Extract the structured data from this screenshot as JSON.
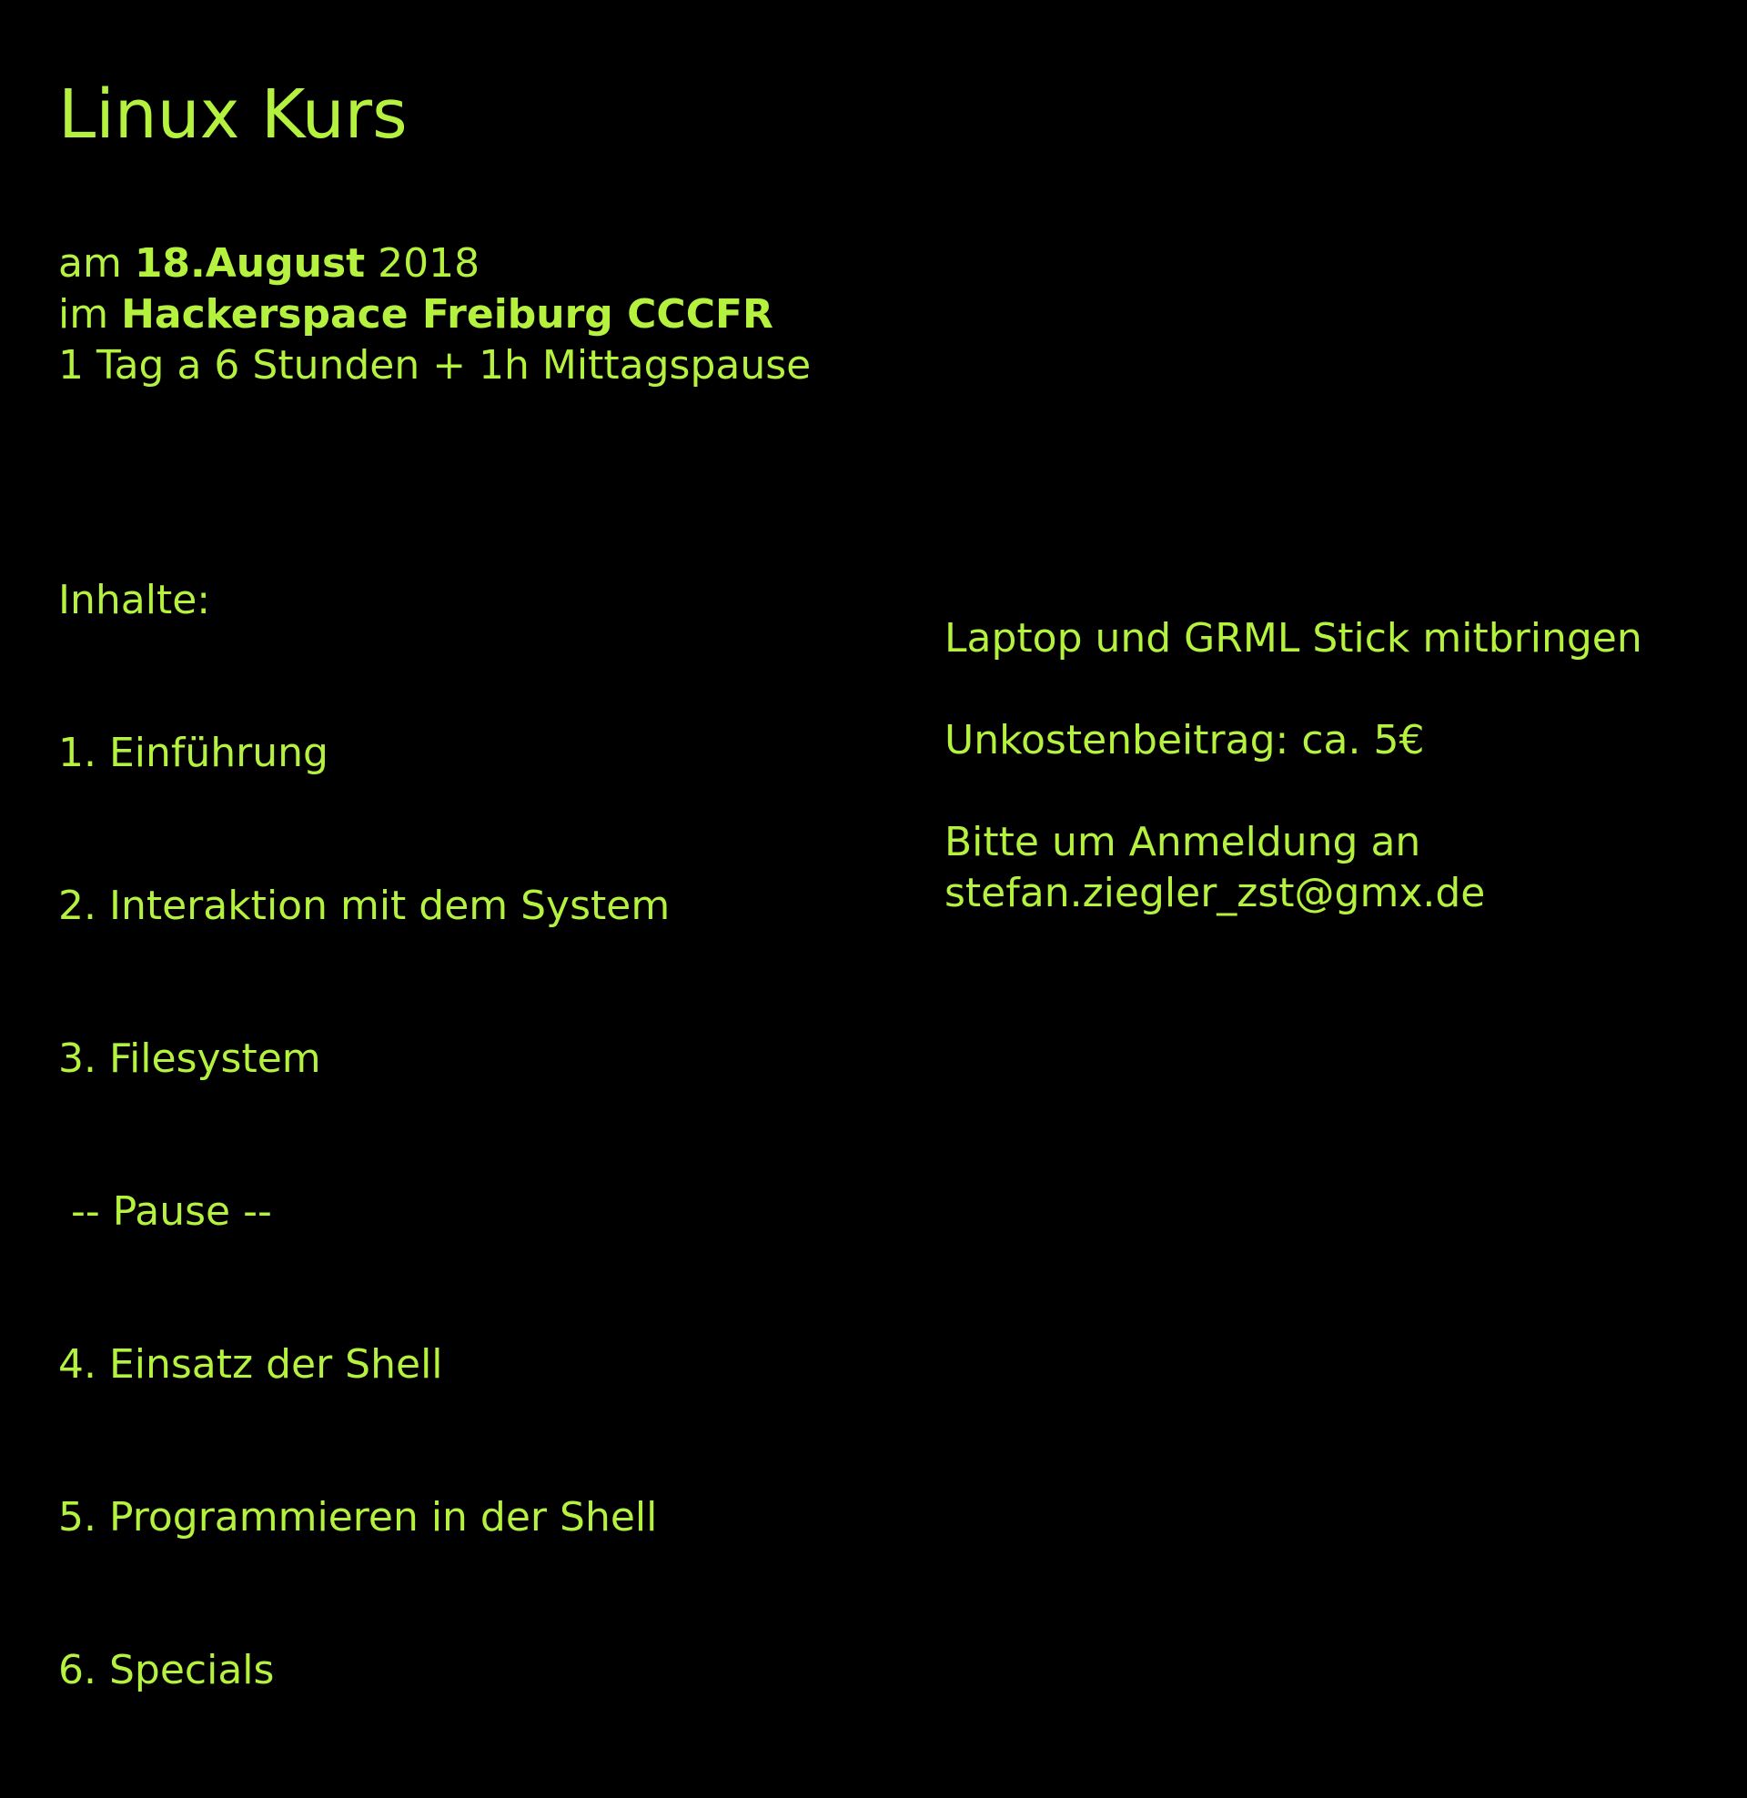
{
  "title": "Linux Kurs",
  "details": {
    "date_prefix": "am ",
    "date_bold": "18.August",
    "date_suffix": " 2018",
    "place_prefix": "im ",
    "place_bold": "Hackerspace Freiburg CCCFR",
    "duration": "1 Tag a 6 Stunden + 1h Mittagspause"
  },
  "contents": {
    "heading": "Inhalte:",
    "items": [
      "1. Einführung",
      "2. Interaktion mit dem System",
      "3. Filesystem",
      " -- Pause --",
      "4. Einsatz der Shell",
      "5. Programmieren in der Shell",
      "6. Specials"
    ]
  },
  "info": {
    "bring": "Laptop und GRML Stick mitbringen",
    "fee": "Unkostenbeitrag: ca. 5€",
    "register_line1": "Bitte um Anmeldung an",
    "register_email": "stefan.ziegler_zst@gmx.de"
  },
  "colors": {
    "background": "#000000",
    "text": "#b5f23f"
  }
}
